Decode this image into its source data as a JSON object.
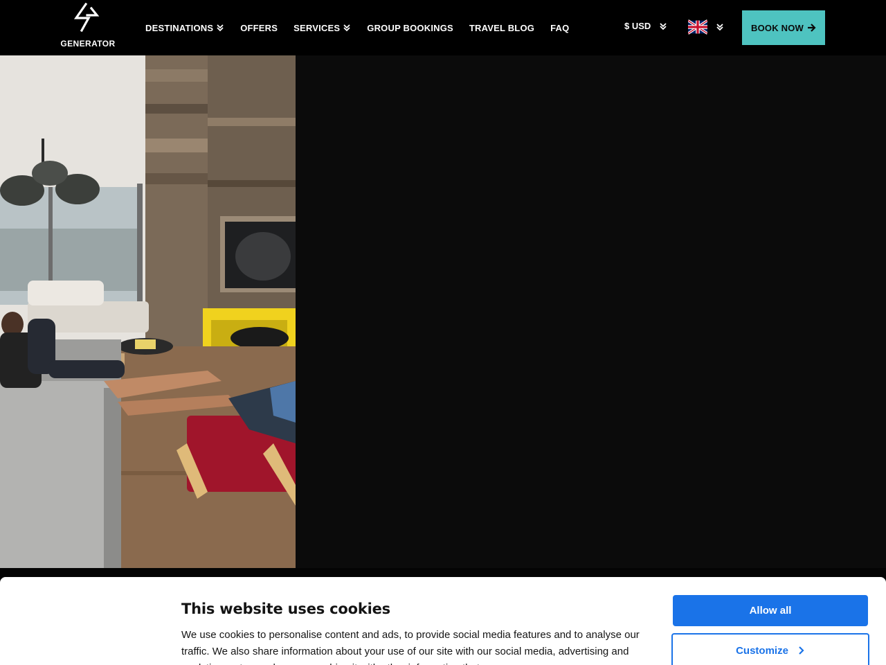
{
  "header": {
    "logo_text": "GENERATOR",
    "nav": [
      {
        "label": "DESTINATIONS",
        "has_dropdown": true
      },
      {
        "label": "OFFERS",
        "has_dropdown": false
      },
      {
        "label": "SERVICES",
        "has_dropdown": true
      },
      {
        "label": "GROUP BOOKINGS",
        "has_dropdown": false
      },
      {
        "label": "TRAVEL BLOG",
        "has_dropdown": false
      },
      {
        "label": "FAQ",
        "has_dropdown": false
      }
    ],
    "currency": "$ USD",
    "language_flag": "uk-flag-icon",
    "book_button": "BOOK NOW"
  },
  "hero": {
    "image": "living-room-photo"
  },
  "cookie_banner": {
    "title": "This website uses cookies",
    "text": "We use cookies to personalise content and ads, to provide social media features and to analyse our traffic. We also share information about your use of our site with our social media, advertising and analytics partners who may combine it with other information that you",
    "allow_all": "Allow all",
    "customize": "Customize"
  },
  "colors": {
    "header_bg": "#000000",
    "book_button_bg": "#4ec3c0",
    "primary_blue": "#1a73e8"
  }
}
